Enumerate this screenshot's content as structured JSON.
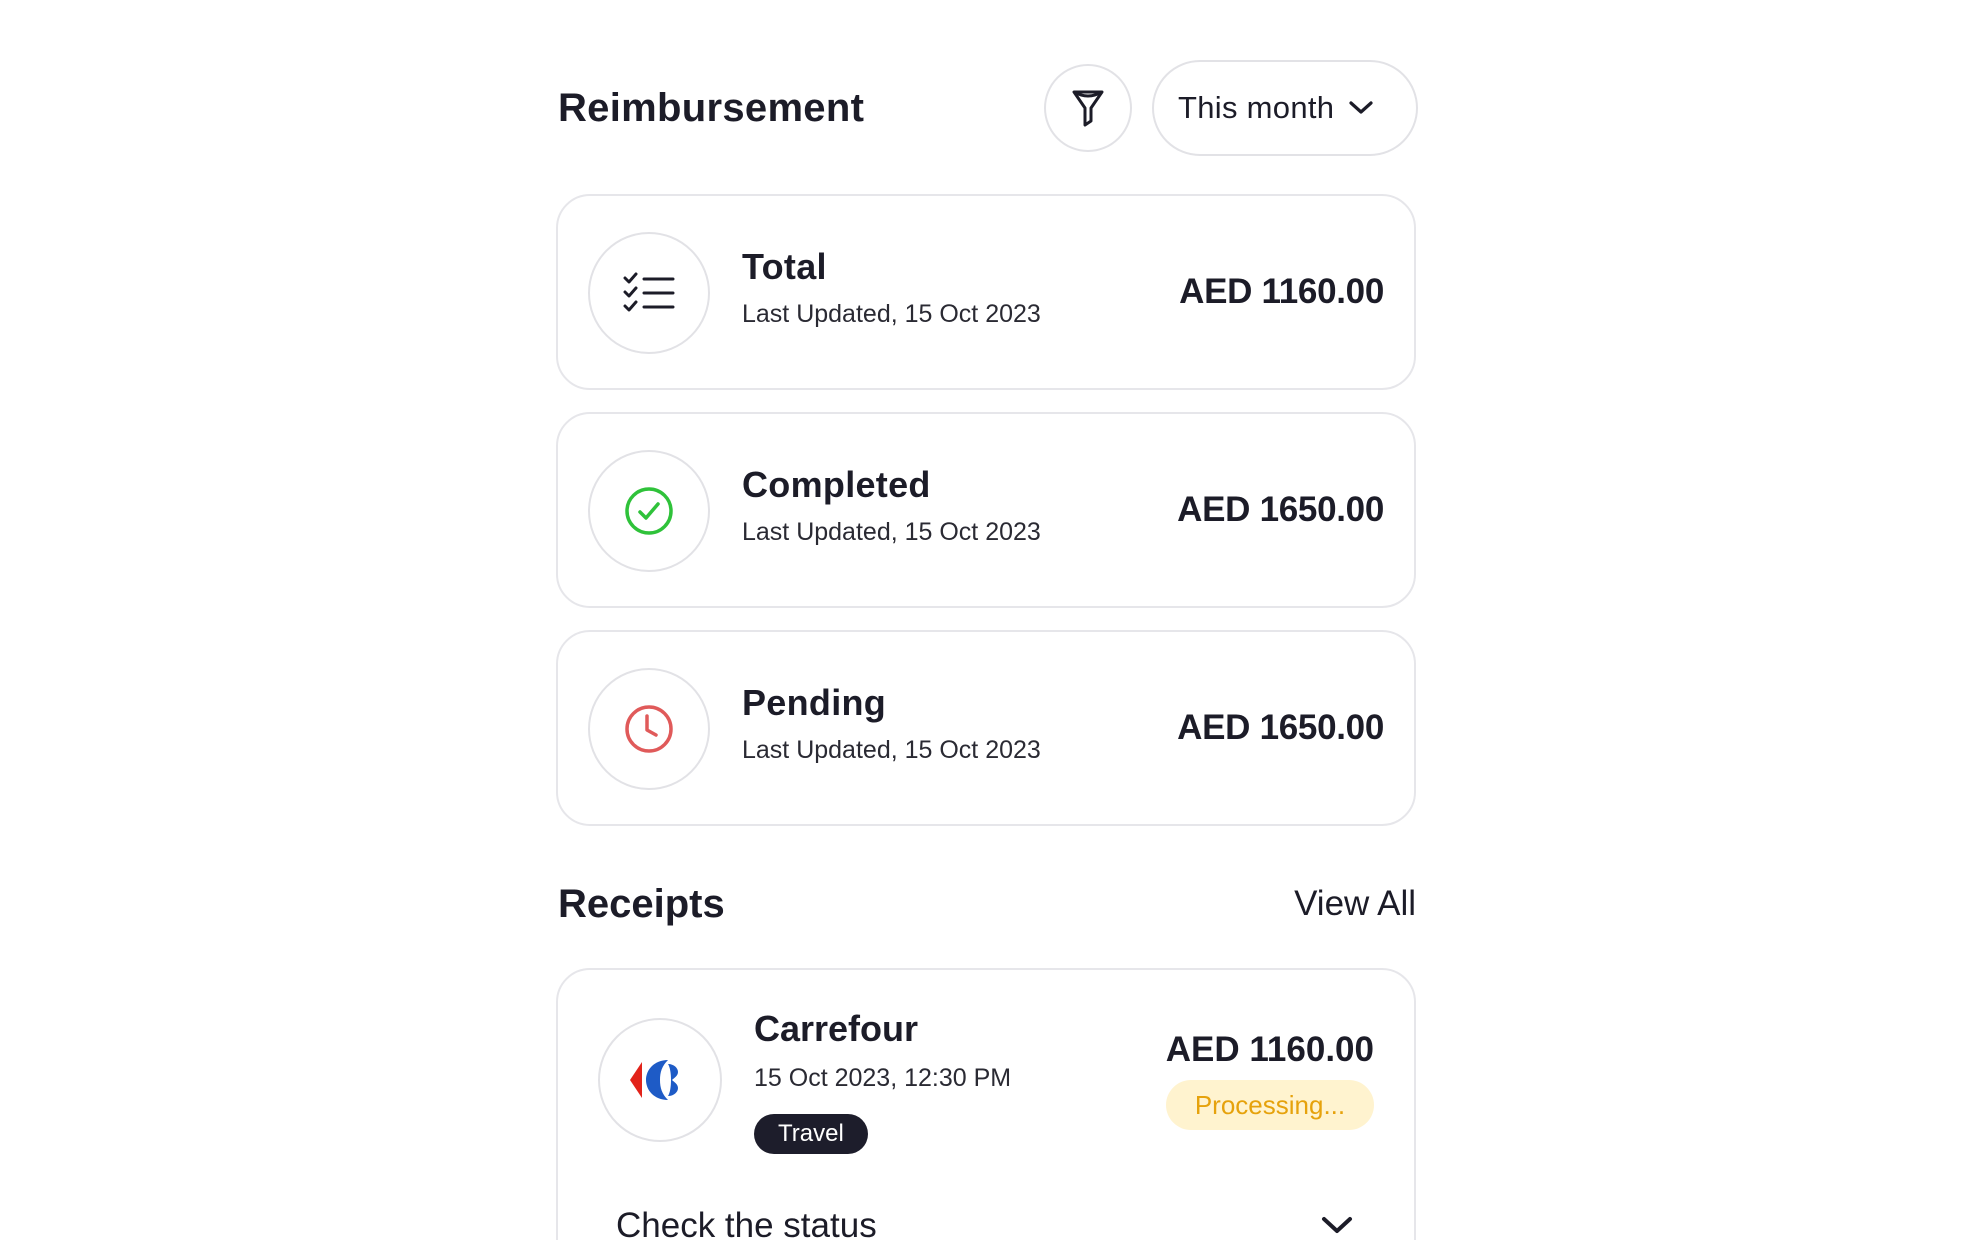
{
  "header": {
    "title": "Reimbursement",
    "filter_icon": "filter-icon",
    "period_select": {
      "value": "This month",
      "icon": "chevron-down-icon"
    }
  },
  "summary": [
    {
      "title": "Total",
      "updated": "Last Updated, 15 Oct 2023",
      "amount": "AED 1160.00",
      "icon": "checklist-icon"
    },
    {
      "title": "Completed",
      "updated": "Last Updated, 15 Oct 2023",
      "amount": "AED 1650.00",
      "icon": "check-circle-icon",
      "color": "#2fc23a"
    },
    {
      "title": "Pending",
      "updated": "Last Updated, 15 Oct 2023",
      "amount": "AED 1650.00",
      "icon": "clock-icon",
      "color": "#e05a5a"
    }
  ],
  "receipts": {
    "title": "Receipts",
    "view_all": "View All",
    "items": [
      {
        "merchant": "Carrefour",
        "datetime": "15 Oct 2023, 12:30 PM",
        "category": "Travel",
        "amount": "AED 1160.00",
        "status": "Processing...",
        "status_color": "#e6a20c",
        "logo": "carrefour-logo",
        "check_status_label": "Check the status"
      }
    ]
  }
}
